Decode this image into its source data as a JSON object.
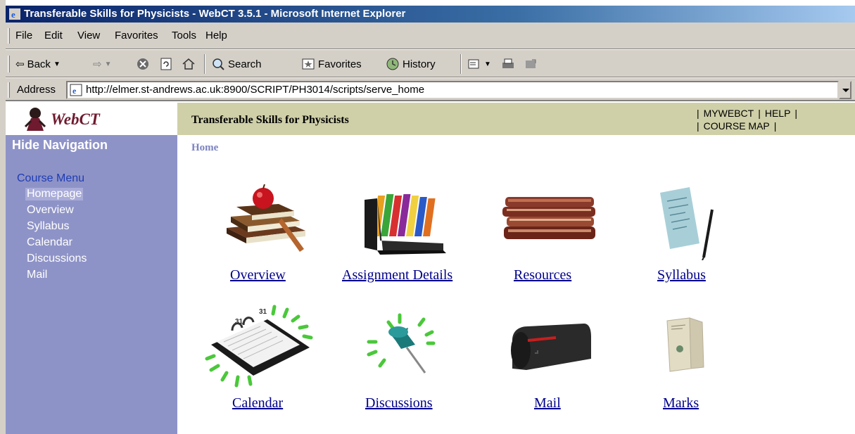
{
  "window": {
    "title": "Transferable Skills for Physicists - WebCT 3.5.1 - Microsoft Internet Explorer"
  },
  "menubar": {
    "items": [
      "File",
      "Edit",
      "View",
      "Favorites",
      "Tools",
      "Help"
    ]
  },
  "toolbar": {
    "back_label": "Back",
    "search_label": "Search",
    "favorites_label": "Favorites",
    "history_label": "History"
  },
  "address": {
    "label": "Address",
    "url": "http://elmer.st-andrews.ac.uk:8900/SCRIPT/PH3014/scripts/serve_home"
  },
  "sidebar": {
    "logo_text": "WebCT",
    "hide_navigation": "Hide Navigation",
    "course_menu_title": "Course Menu",
    "items": [
      "Homepage",
      "Overview",
      "Syllabus",
      "Calendar",
      "Discussions",
      "Mail"
    ]
  },
  "header": {
    "course_title": "Transferable Skills for Physicists",
    "links": [
      "MYWEBCT",
      "HELP",
      "COURSE MAP"
    ]
  },
  "breadcrumb": "Home",
  "tools": [
    {
      "label": "Overview",
      "icon": "books-apple-icon"
    },
    {
      "label": "Assignment Details",
      "icon": "file-sorter-icon"
    },
    {
      "label": "Resources",
      "icon": "stacked-books-icon"
    },
    {
      "label": "Syllabus",
      "icon": "document-pen-icon"
    },
    {
      "label": "Calendar",
      "icon": "desk-calendar-icon"
    },
    {
      "label": "Discussions",
      "icon": "pushpin-icon"
    },
    {
      "label": "Mail",
      "icon": "mailbox-icon"
    },
    {
      "label": "Marks",
      "icon": "report-card-icon"
    }
  ],
  "colors": {
    "sidebar": "#8e93c7",
    "header": "#cfd0a8",
    "link": "#00008b",
    "titlebar": "#0a246a"
  }
}
